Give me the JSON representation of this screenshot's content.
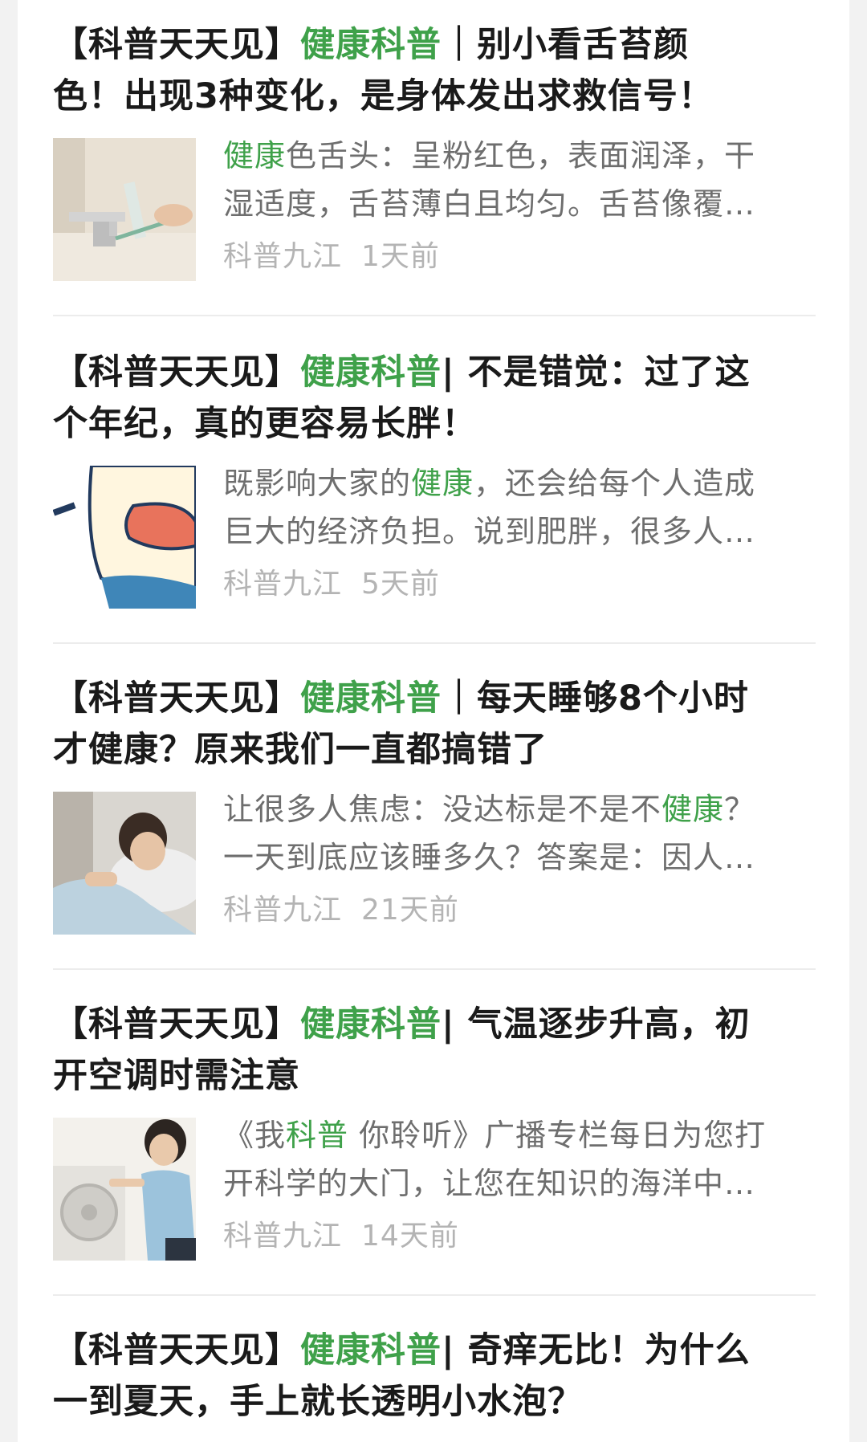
{
  "articles": [
    {
      "title_prefix": "【科普天天见】",
      "title_tag": "健康科普",
      "title_line1_rest": "｜别小看舌苔颜",
      "title_line2": "色！出现3种变化，是身体发出求救信号！",
      "summary_line1_hl": "健康",
      "summary_line1_rest": "色舌头：呈粉红色，表面润泽，干",
      "summary_line2": "湿适度，舌苔薄白且均匀。舌苔像覆…",
      "source": "科普九江",
      "time": "1天前",
      "thumbnail_icon": "toothbrush-faucet-photo"
    },
    {
      "title_prefix": "【科普天天见】",
      "title_tag": "健康科普",
      "title_line1_rest": "| 不是错觉：过了这",
      "title_line2": "个年纪，真的更容易长胖！",
      "summary_line1_pre": "既影响大家的",
      "summary_line1_hl": "健康",
      "summary_line1_post": "，还会给每个人造成",
      "summary_line2": "巨大的经济负担。说到肥胖，很多人…",
      "source": "科普九江",
      "time": "5天前",
      "thumbnail_icon": "cartoon-character-illustration"
    },
    {
      "title_prefix": "【科普天天见】",
      "title_tag": "健康科普",
      "title_line1_rest": "｜每天睡够8个小时",
      "title_line2": "才健康？原来我们一直都搞错了",
      "summary_line1_pre": "让很多人焦虑：没达标是不是不",
      "summary_line1_hl": "健康",
      "summary_line1_post": "？",
      "summary_line2": "一天到底应该睡多久？答案是：因人…",
      "source": "科普九江",
      "time": "21天前",
      "thumbnail_icon": "sleeping-person-photo"
    },
    {
      "title_prefix": "【科普天天见】",
      "title_tag": "健康科普",
      "title_line1_rest": "| 气温逐步升高，初",
      "title_line2": "开空调时需注意",
      "summary_line1_pre": "《我",
      "summary_line1_hl": "科普",
      "summary_line1_post": " 你聆听》广播专栏每日为您打",
      "summary_line2": "开科学的大门，让您在知识的海洋中…",
      "source": "科普九江",
      "time": "14天前",
      "thumbnail_icon": "air-conditioner-cleaning-photo"
    },
    {
      "title_prefix": "【科普天天见】",
      "title_tag": "健康科普",
      "title_line1_rest": "| 奇痒无比！为什么",
      "title_line2": "一到夏天，手上就长透明小水泡？"
    }
  ]
}
